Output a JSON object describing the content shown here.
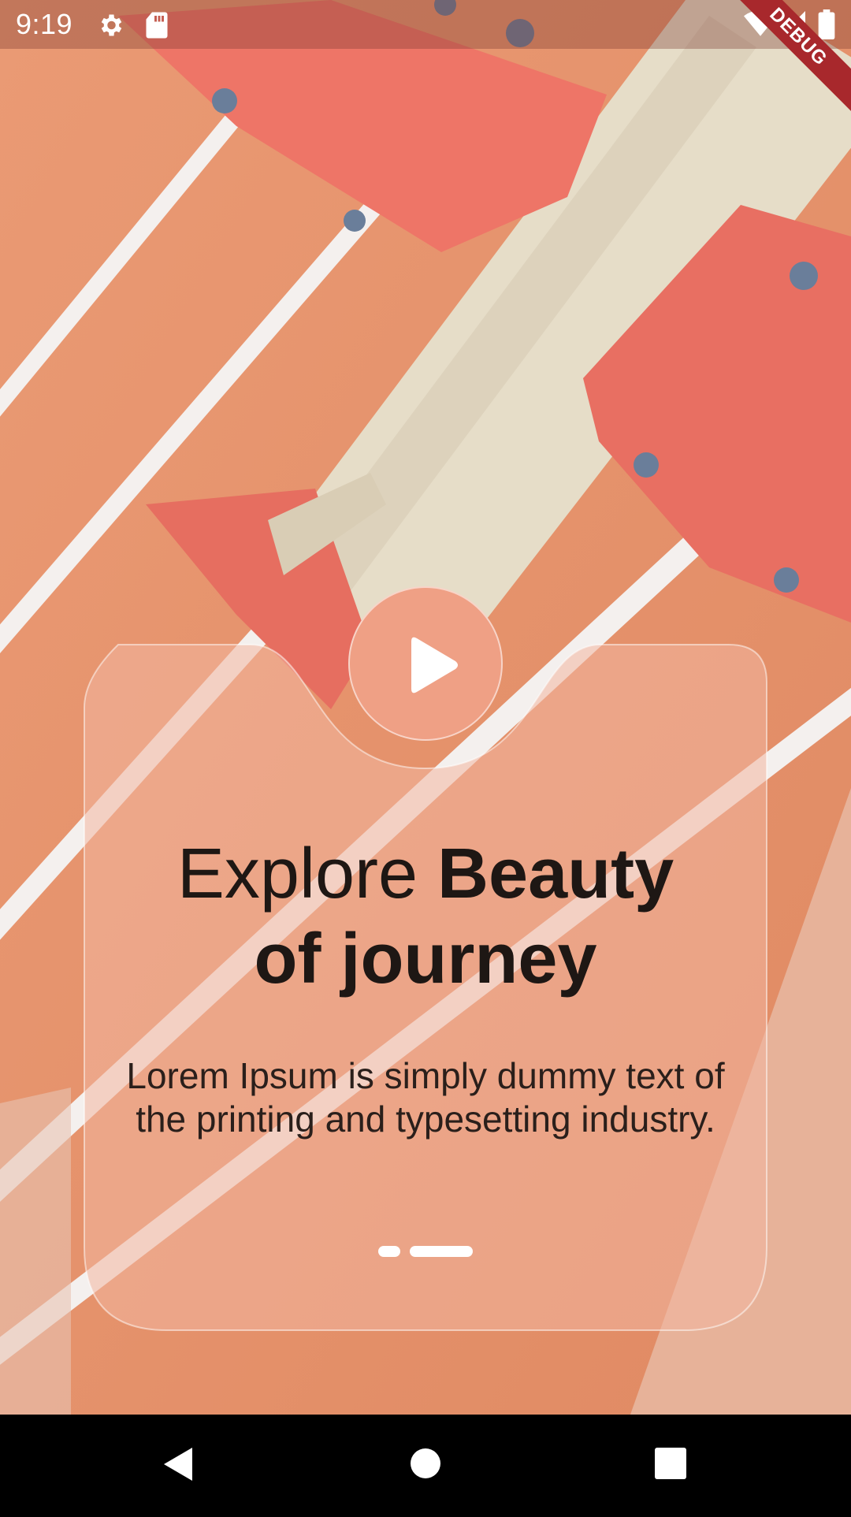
{
  "status_bar": {
    "time": "9:19",
    "icons": [
      "settings-icon",
      "sd-card-icon",
      "wifi-icon",
      "signal-icon",
      "battery-icon"
    ],
    "debug_label": "DEBUG"
  },
  "onboarding": {
    "headline_regular": "Explore ",
    "headline_bold_1": "Beauty",
    "headline_bold_2": "of journey",
    "description": "Lorem Ipsum is simply dummy text of the printing and typesetting industry.",
    "page_indicator": {
      "count": 2,
      "active_index": 1
    },
    "play_button_icon": "play-icon"
  },
  "navigation_bar": {
    "buttons": [
      "back-icon",
      "home-icon",
      "recents-icon"
    ]
  },
  "colors": {
    "background": "#E8936C",
    "card_tint": "#EFA085",
    "text": "#1E1714",
    "debug_ribbon": "#A8282C"
  }
}
